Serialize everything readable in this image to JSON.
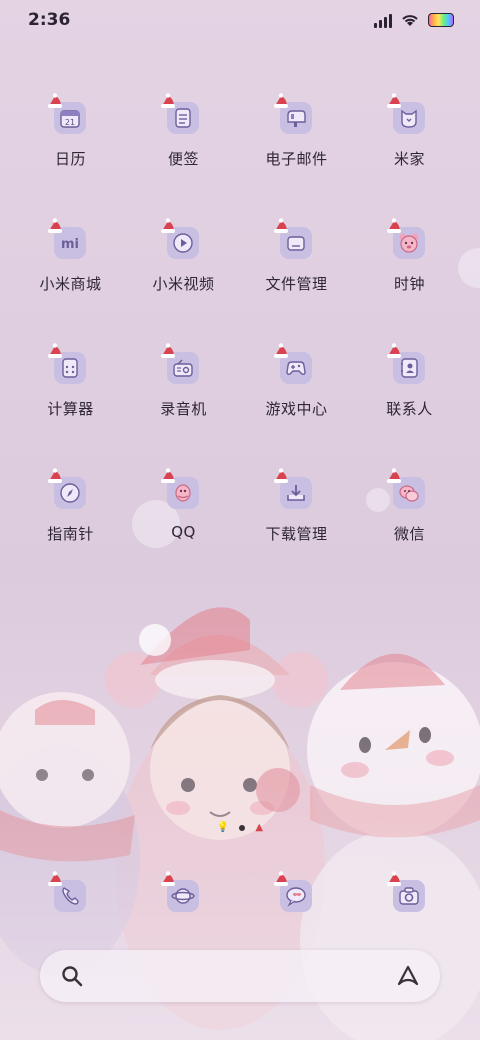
{
  "status_bar": {
    "time": "2:36"
  },
  "apps": [
    {
      "label": "日历",
      "icon": "calendar-icon",
      "badge_text": "21"
    },
    {
      "label": "便签",
      "icon": "notes-icon"
    },
    {
      "label": "电子邮件",
      "icon": "mailbox-icon"
    },
    {
      "label": "米家",
      "icon": "mijia-icon"
    },
    {
      "label": "小米商城",
      "icon": "mi-store-icon",
      "badge_text": "mi"
    },
    {
      "label": "小米视频",
      "icon": "video-play-icon"
    },
    {
      "label": "文件管理",
      "icon": "folder-icon"
    },
    {
      "label": "时钟",
      "icon": "bear-clock-icon"
    },
    {
      "label": "计算器",
      "icon": "calculator-icon"
    },
    {
      "label": "录音机",
      "icon": "radio-recorder-icon"
    },
    {
      "label": "游戏中心",
      "icon": "gamepad-icon"
    },
    {
      "label": "联系人",
      "icon": "contacts-icon"
    },
    {
      "label": "指南针",
      "icon": "compass-icon"
    },
    {
      "label": "QQ",
      "icon": "qq-penguin-icon"
    },
    {
      "label": "下载管理",
      "icon": "download-icon"
    },
    {
      "label": "微信",
      "icon": "wechat-icon"
    }
  ],
  "dock": [
    {
      "icon": "phone-icon"
    },
    {
      "icon": "browser-planet-icon"
    },
    {
      "icon": "messages-icon"
    },
    {
      "icon": "camera-icon"
    }
  ],
  "pager": {
    "pages": 3,
    "active": 1
  },
  "colors": {
    "tile": "#c9bfe3",
    "hat_red": "#d9434f",
    "background": "#e3d3e3"
  }
}
